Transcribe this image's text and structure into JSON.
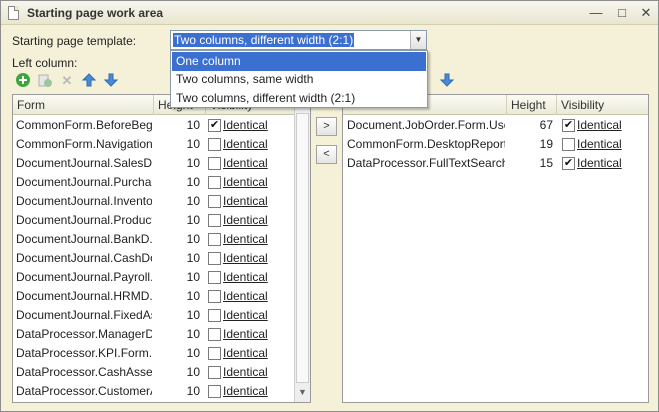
{
  "window": {
    "title": "Starting page work area",
    "minimize_icon": "minimize-icon",
    "maximize_icon": "maximize-icon",
    "close_icon": "close-icon"
  },
  "template": {
    "label": "Starting page template:",
    "value": "Two columns, different width (2:1)",
    "options": [
      "One column",
      "Two columns, same width",
      "Two columns, different width (2:1)"
    ],
    "highlighted_option": "One column"
  },
  "left": {
    "label": "Left column:",
    "toolbar": [
      "add-icon",
      "copy-icon",
      "delete-icon",
      "move-up-icon",
      "move-down-icon"
    ],
    "columns": {
      "form": "Form",
      "height": "Height",
      "visibility": "Visibility"
    },
    "rows": [
      {
        "form": "CommonForm.BeforeBegi...",
        "height": "10",
        "checked": true,
        "vis": "Identical"
      },
      {
        "form": "CommonForm.Navigation...",
        "height": "10",
        "checked": false,
        "vis": "Identical"
      },
      {
        "form": "DocumentJournal.SalesD...",
        "height": "10",
        "checked": false,
        "vis": "Identical"
      },
      {
        "form": "DocumentJournal.Purcha...",
        "height": "10",
        "checked": false,
        "vis": "Identical"
      },
      {
        "form": "DocumentJournal.Invento...",
        "height": "10",
        "checked": false,
        "vis": "Identical"
      },
      {
        "form": "DocumentJournal.Product...",
        "height": "10",
        "checked": false,
        "vis": "Identical"
      },
      {
        "form": "DocumentJournal.BankD...",
        "height": "10",
        "checked": false,
        "vis": "Identical"
      },
      {
        "form": "DocumentJournal.CashDo...",
        "height": "10",
        "checked": false,
        "vis": "Identical"
      },
      {
        "form": "DocumentJournal.Payroll...",
        "height": "10",
        "checked": false,
        "vis": "Identical"
      },
      {
        "form": "DocumentJournal.HRMD...",
        "height": "10",
        "checked": false,
        "vis": "Identical"
      },
      {
        "form": "DocumentJournal.FixedAs...",
        "height": "10",
        "checked": false,
        "vis": "Identical"
      },
      {
        "form": "DataProcessor.ManagerD...",
        "height": "10",
        "checked": false,
        "vis": "Identical"
      },
      {
        "form": "DataProcessor.KPI.Form....",
        "height": "10",
        "checked": false,
        "vis": "Identical"
      },
      {
        "form": "DataProcessor.CashAsset...",
        "height": "10",
        "checked": false,
        "vis": "Identical"
      },
      {
        "form": "DataProcessor.CustomerA...",
        "height": "10",
        "checked": false,
        "vis": "Identical"
      }
    ]
  },
  "move": {
    "right_label": ">",
    "left_label": "<"
  },
  "right": {
    "toolbar": [
      "move-down-icon"
    ],
    "columns": {
      "height": "Height",
      "visibility": "Visibility"
    },
    "rows": [
      {
        "form": "Document.JobOrder.Form.User...",
        "height": "67",
        "checked": true,
        "vis": "Identical"
      },
      {
        "form": "CommonForm.DesktopReports...",
        "height": "19",
        "checked": false,
        "vis": "Identical"
      },
      {
        "form": "DataProcessor.FullTextSearchI...",
        "height": "15",
        "checked": true,
        "vis": "Identical"
      }
    ]
  },
  "colors": {
    "accent": "#3b6fd0",
    "window_bg": "#f4f1d8",
    "add_green": "#3ea63e",
    "arrow_blue": "#3a7cc9",
    "delete_gray": "#b9b9b9"
  }
}
